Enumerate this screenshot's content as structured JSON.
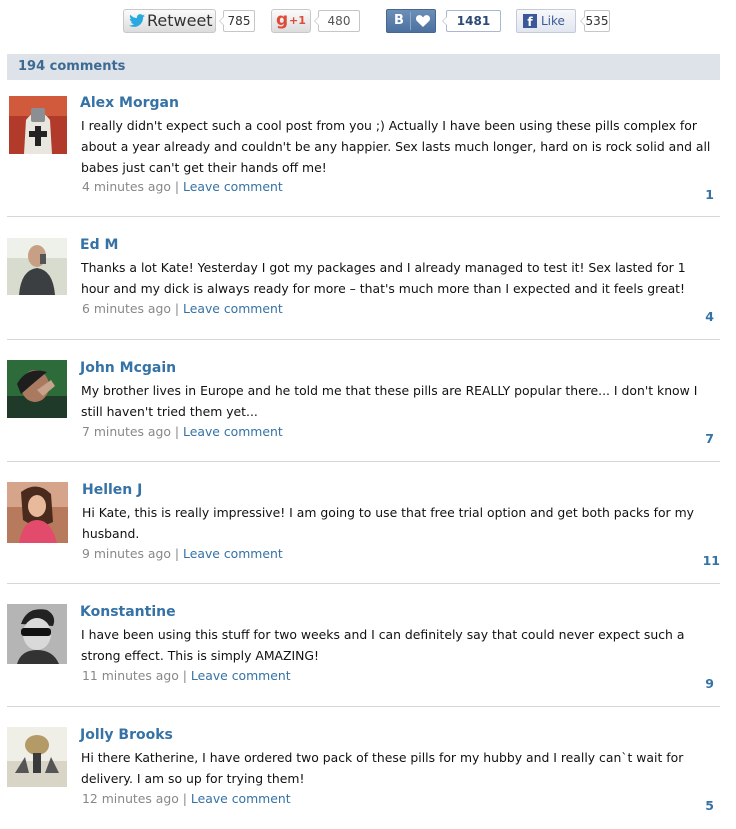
{
  "social": {
    "retweet_label": "Retweet",
    "retweet_count": "785",
    "gplus_label": "+1",
    "gplus_count": "480",
    "vk_label": "B",
    "vk_count": "1481",
    "fb_label": "Like",
    "fb_count": "535"
  },
  "comments_header": "194 comments",
  "leave_comment_label": "Leave comment",
  "comments": [
    {
      "author": "Alex Morgan",
      "text": "I really didn't expect such a cool post from you ;) Actually I have been using these pills complex for about a year already and couldn't be any happier. Sex lasts much longer, hard on is rock solid and all babes just can't get their hands off me!",
      "time": "4 minutes ago",
      "count": "1"
    },
    {
      "author": "Ed M",
      "text": "Thanks a lot Kate! Yesterday I got my packages and I already managed to test it! Sex lasted for 1 hour and my dick is always ready for more – that's much more than I expected and it feels great!",
      "time": "6 minutes ago",
      "count": "4"
    },
    {
      "author": "John Mcgain",
      "text": "My brother lives in Europe and he told me that these pills are REALLY popular there... I don't know I still haven't tried them yet...",
      "time": "7 minutes ago",
      "count": "7"
    },
    {
      "author": "Hellen J",
      "text": "Hi Kate, this is really impressive! I am going to use that free trial option and get both packs for my husband.",
      "time": "9 minutes ago",
      "count": "11"
    },
    {
      "author": "Konstantine",
      "text": "I have been using this stuff for two weeks and I can definitely say that could never expect such a strong effect. This is simply AMAZING!",
      "time": "11 minutes ago",
      "count": "9"
    },
    {
      "author": "Jolly Brooks",
      "text": "Hi there Katherine, I have ordered two pack of these pills for my hubby and I really can`t wait for delivery. I am so up for trying them!",
      "time": "12 minutes ago",
      "count": "5"
    }
  ]
}
